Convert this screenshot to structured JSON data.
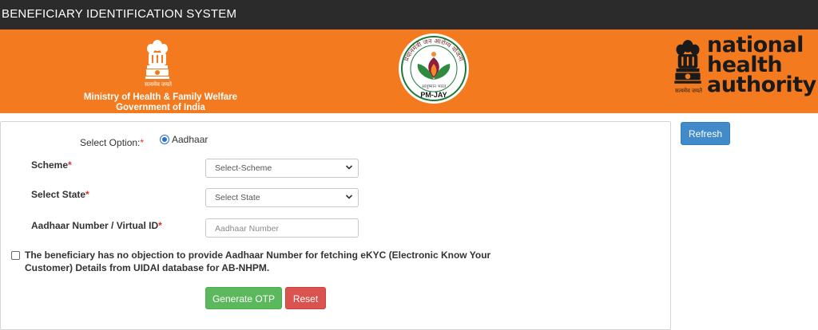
{
  "app": {
    "title": "BENEFICIARY IDENTIFICATION SYSTEM"
  },
  "banner": {
    "ministry": {
      "motto": "सत्यमेव जयते",
      "line1": "Ministry of Health & Family Welfare",
      "line2": "Government of India"
    },
    "pmjay": {
      "arc_text": "प्रधानमंत्री जन आरोग्य योजना",
      "subtext": "आयुष्मान भारत",
      "badge": "PM-JAY"
    },
    "nha": {
      "wordmark": [
        "national",
        "health",
        "authority"
      ],
      "motto": "सत्यमेव जयते"
    }
  },
  "form": {
    "select_option_label": "Select Option:",
    "radio_aadhaar": "Aadhaar",
    "scheme_label": "Scheme",
    "scheme_value": "Select-Scheme",
    "state_label": "Select State",
    "state_value": "Select State",
    "aadhaar_label": "Aadhaar Number / Virtual ID",
    "aadhaar_placeholder": "Aadhaar Number",
    "required_mark": "*",
    "consent_text": "The beneficiary has no objection to provide Aadhaar Number for fetching eKYC (Electronic Know Your Customer) Details from UIDAI database for AB-NHPM.",
    "generate_otp": "Generate OTP",
    "reset": "Reset"
  },
  "actions": {
    "refresh": "Refresh"
  },
  "colors": {
    "topbar": "#2b2b2b",
    "banner": "#f47a1f",
    "success": "#5cb85c",
    "danger": "#d9534f",
    "primary": "#428bca",
    "required": "#d9302b"
  },
  "icons": [
    "state-emblem-icon",
    "pmjay-logo-icon",
    "chevron-down-icon"
  ]
}
